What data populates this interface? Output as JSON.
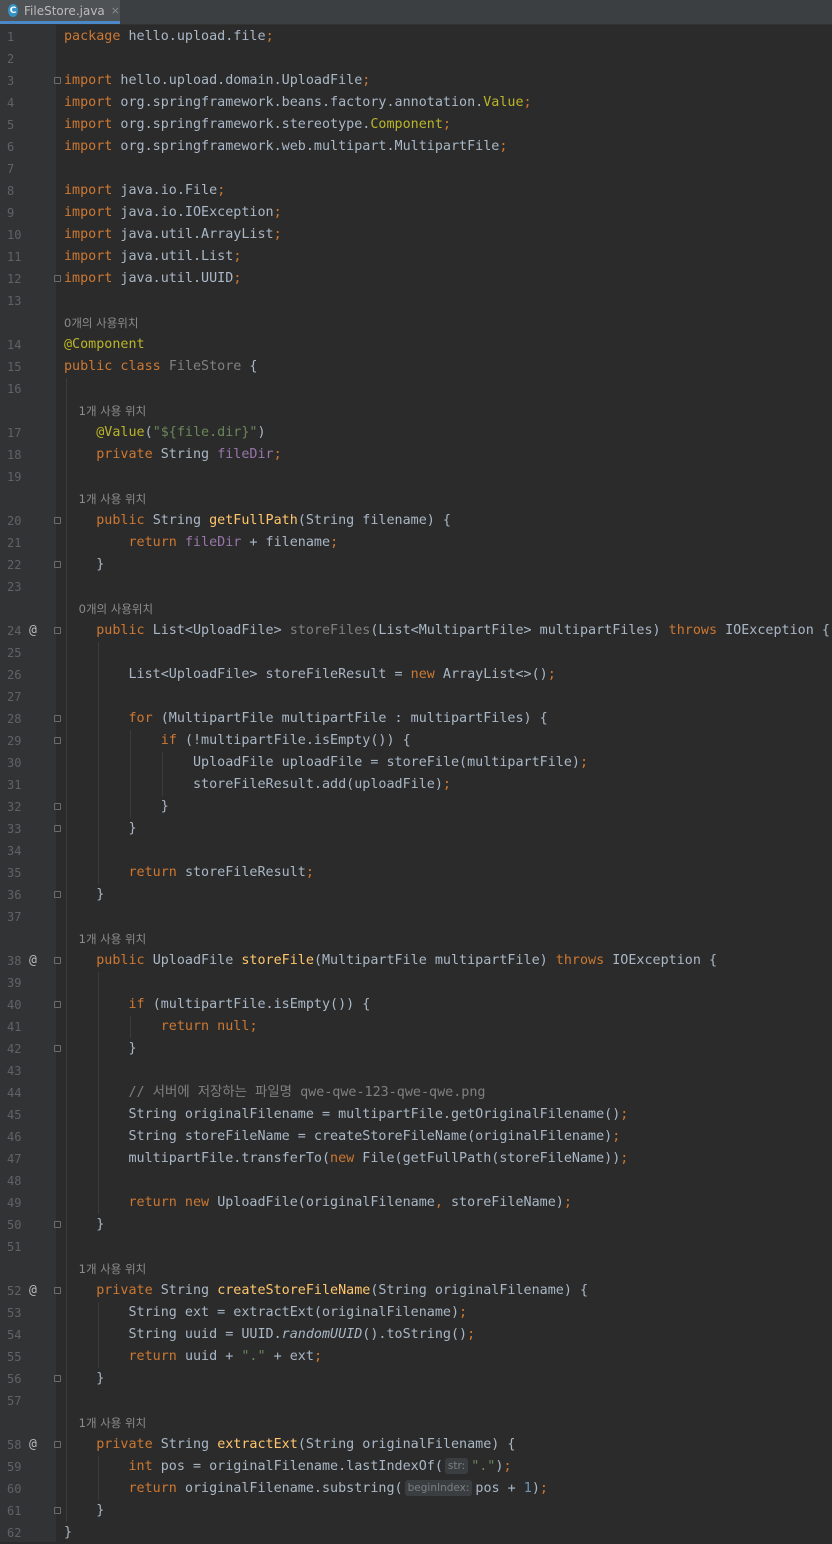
{
  "tab": {
    "filename": "FileStore.java",
    "icon": "class-icon",
    "icon_letter": "C",
    "close": "×"
  },
  "rows": [
    {
      "t": "line",
      "n": "1",
      "c": [
        [
          "package",
          "kw"
        ],
        [
          " hello.upload.file",
          ""
        ],
        [
          ";",
          "kw"
        ]
      ]
    },
    {
      "t": "line",
      "n": "2",
      "c": []
    },
    {
      "t": "line",
      "n": "3",
      "f": 1,
      "c": [
        [
          "import",
          "kw"
        ],
        [
          " hello.upload.domain.UploadFile",
          ""
        ],
        [
          ";",
          "kw"
        ]
      ]
    },
    {
      "t": "line",
      "n": "4",
      "c": [
        [
          "import",
          "kw"
        ],
        [
          " org.springframework.beans.factory.annotation.",
          ""
        ],
        [
          "Value",
          "ann"
        ],
        [
          ";",
          "kw"
        ]
      ]
    },
    {
      "t": "line",
      "n": "5",
      "c": [
        [
          "import",
          "kw"
        ],
        [
          " org.springframework.stereotype.",
          ""
        ],
        [
          "Component",
          "ann"
        ],
        [
          ";",
          "kw"
        ]
      ]
    },
    {
      "t": "line",
      "n": "6",
      "c": [
        [
          "import",
          "kw"
        ],
        [
          " org.springframework.web.multipart.MultipartFile",
          ""
        ],
        [
          ";",
          "kw"
        ]
      ]
    },
    {
      "t": "line",
      "n": "7",
      "c": []
    },
    {
      "t": "line",
      "n": "8",
      "c": [
        [
          "import",
          "kw"
        ],
        [
          " java.io.File",
          ""
        ],
        [
          ";",
          "kw"
        ]
      ]
    },
    {
      "t": "line",
      "n": "9",
      "c": [
        [
          "import",
          "kw"
        ],
        [
          " java.io.IOException",
          ""
        ],
        [
          ";",
          "kw"
        ]
      ]
    },
    {
      "t": "line",
      "n": "10",
      "c": [
        [
          "import",
          "kw"
        ],
        [
          " java.util.ArrayList",
          ""
        ],
        [
          ";",
          "kw"
        ]
      ]
    },
    {
      "t": "line",
      "n": "11",
      "c": [
        [
          "import",
          "kw"
        ],
        [
          " java.util.List",
          ""
        ],
        [
          ";",
          "kw"
        ]
      ]
    },
    {
      "t": "line",
      "n": "12",
      "f": 1,
      "c": [
        [
          "import",
          "kw"
        ],
        [
          " java.util.UUID",
          ""
        ],
        [
          ";",
          "kw"
        ]
      ]
    },
    {
      "t": "line",
      "n": "13",
      "c": []
    },
    {
      "t": "hint",
      "c": [
        [
          "0개의 사용위치",
          ""
        ]
      ]
    },
    {
      "t": "line",
      "n": "14",
      "c": [
        [
          "@Component",
          "ann"
        ]
      ]
    },
    {
      "t": "line",
      "n": "15",
      "c": [
        [
          "public class ",
          "kw"
        ],
        [
          "FileStore",
          "gr"
        ],
        [
          " {",
          ""
        ]
      ]
    },
    {
      "t": "line",
      "n": "16",
      "c": []
    },
    {
      "t": "hint",
      "c": [
        [
          "    1개 사용 위치",
          ""
        ]
      ]
    },
    {
      "t": "line",
      "n": "17",
      "c": [
        [
          "    ",
          ""
        ],
        [
          "@Value",
          "ann"
        ],
        [
          "(",
          ""
        ],
        [
          "\"${file.dir}\"",
          "str"
        ],
        [
          ")",
          ""
        ]
      ]
    },
    {
      "t": "line",
      "n": "18",
      "c": [
        [
          "    ",
          ""
        ],
        [
          "private ",
          "kw"
        ],
        [
          "String ",
          ""
        ],
        [
          "fileDir",
          "fld"
        ],
        [
          ";",
          "kw"
        ]
      ]
    },
    {
      "t": "line",
      "n": "19",
      "c": []
    },
    {
      "t": "hint",
      "c": [
        [
          "    1개 사용 위치",
          ""
        ]
      ]
    },
    {
      "t": "line",
      "n": "20",
      "f": 1,
      "c": [
        [
          "    ",
          ""
        ],
        [
          "public ",
          "kw"
        ],
        [
          "String ",
          ""
        ],
        [
          "getFullPath",
          "fn"
        ],
        [
          "(String filename) {",
          ""
        ]
      ]
    },
    {
      "t": "line",
      "n": "21",
      "c": [
        [
          "        ",
          ""
        ],
        [
          "return ",
          "kw"
        ],
        [
          "fileDir",
          "fld"
        ],
        [
          " + filename",
          ""
        ],
        [
          ";",
          "kw"
        ]
      ]
    },
    {
      "t": "line",
      "n": "22",
      "f": 1,
      "c": [
        [
          "    }",
          ""
        ]
      ]
    },
    {
      "t": "line",
      "n": "23",
      "c": []
    },
    {
      "t": "hint",
      "c": [
        [
          "    0개의 사용위치",
          ""
        ]
      ]
    },
    {
      "t": "line",
      "n": "24",
      "m": "@",
      "f": 1,
      "c": [
        [
          "    ",
          ""
        ],
        [
          "public ",
          "kw"
        ],
        [
          "List<UploadFile> ",
          ""
        ],
        [
          "storeFiles",
          "gr"
        ],
        [
          "(List<MultipartFile> multipartFiles) ",
          ""
        ],
        [
          "throws ",
          "kw"
        ],
        [
          "IOException {",
          ""
        ]
      ]
    },
    {
      "t": "line",
      "n": "25",
      "c": []
    },
    {
      "t": "line",
      "n": "26",
      "c": [
        [
          "        List<UploadFile> storeFileResult = ",
          ""
        ],
        [
          "new ",
          "kw"
        ],
        [
          "ArrayList<>()",
          ""
        ],
        [
          ";",
          "kw"
        ]
      ]
    },
    {
      "t": "line",
      "n": "27",
      "c": []
    },
    {
      "t": "line",
      "n": "28",
      "f": 1,
      "c": [
        [
          "        ",
          ""
        ],
        [
          "for ",
          "kw"
        ],
        [
          "(MultipartFile multipartFile : multipartFiles) {",
          ""
        ]
      ]
    },
    {
      "t": "line",
      "n": "29",
      "f": 1,
      "c": [
        [
          "            ",
          ""
        ],
        [
          "if ",
          "kw"
        ],
        [
          "(!multipartFile.isEmpty()) {",
          ""
        ]
      ]
    },
    {
      "t": "line",
      "n": "30",
      "c": [
        [
          "                UploadFile uploadFile = storeFile(multipartFile)",
          ""
        ],
        [
          ";",
          "kw"
        ]
      ]
    },
    {
      "t": "line",
      "n": "31",
      "c": [
        [
          "                storeFileResult.add(uploadFile)",
          ""
        ],
        [
          ";",
          "kw"
        ]
      ]
    },
    {
      "t": "line",
      "n": "32",
      "f": 1,
      "c": [
        [
          "            }",
          ""
        ]
      ]
    },
    {
      "t": "line",
      "n": "33",
      "f": 1,
      "c": [
        [
          "        }",
          ""
        ]
      ]
    },
    {
      "t": "line",
      "n": "34",
      "c": []
    },
    {
      "t": "line",
      "n": "35",
      "c": [
        [
          "        ",
          ""
        ],
        [
          "return ",
          "kw"
        ],
        [
          "storeFileResult",
          ""
        ],
        [
          ";",
          "kw"
        ]
      ]
    },
    {
      "t": "line",
      "n": "36",
      "f": 1,
      "c": [
        [
          "    }",
          ""
        ]
      ]
    },
    {
      "t": "line",
      "n": "37",
      "c": []
    },
    {
      "t": "hint",
      "c": [
        [
          "    1개 사용 위치",
          ""
        ]
      ]
    },
    {
      "t": "line",
      "n": "38",
      "m": "@",
      "f": 1,
      "c": [
        [
          "    ",
          ""
        ],
        [
          "public ",
          "kw"
        ],
        [
          "UploadFile ",
          ""
        ],
        [
          "storeFile",
          "fn"
        ],
        [
          "(MultipartFile multipartFile) ",
          ""
        ],
        [
          "throws ",
          "kw"
        ],
        [
          "IOException {",
          ""
        ]
      ]
    },
    {
      "t": "line",
      "n": "39",
      "c": []
    },
    {
      "t": "line",
      "n": "40",
      "f": 1,
      "c": [
        [
          "        ",
          ""
        ],
        [
          "if ",
          "kw"
        ],
        [
          "(multipartFile.isEmpty()) {",
          ""
        ]
      ]
    },
    {
      "t": "line",
      "n": "41",
      "c": [
        [
          "            ",
          ""
        ],
        [
          "return null",
          "kw"
        ],
        [
          ";",
          "kw"
        ]
      ]
    },
    {
      "t": "line",
      "n": "42",
      "f": 1,
      "c": [
        [
          "        }",
          ""
        ]
      ]
    },
    {
      "t": "line",
      "n": "43",
      "c": []
    },
    {
      "t": "line",
      "n": "44",
      "c": [
        [
          "        ",
          ""
        ],
        [
          "// 서버에 저장하는 파일명 qwe-qwe-123-qwe-qwe.png",
          "cmt"
        ]
      ]
    },
    {
      "t": "line",
      "n": "45",
      "c": [
        [
          "        String originalFilename = multipartFile.getOriginalFilename()",
          ""
        ],
        [
          ";",
          "kw"
        ]
      ]
    },
    {
      "t": "line",
      "n": "46",
      "c": [
        [
          "        String storeFileName = createStoreFileName(originalFilename)",
          ""
        ],
        [
          ";",
          "kw"
        ]
      ]
    },
    {
      "t": "line",
      "n": "47",
      "c": [
        [
          "        multipartFile.transferTo(",
          ""
        ],
        [
          "new ",
          "kw"
        ],
        [
          "File(getFullPath(storeFileName))",
          ""
        ],
        [
          ";",
          "kw"
        ]
      ]
    },
    {
      "t": "line",
      "n": "48",
      "c": []
    },
    {
      "t": "line",
      "n": "49",
      "c": [
        [
          "        ",
          ""
        ],
        [
          "return new ",
          "kw"
        ],
        [
          "UploadFile(originalFilename",
          ""
        ],
        [
          ", ",
          "kw"
        ],
        [
          "storeFileName)",
          ""
        ],
        [
          ";",
          "kw"
        ]
      ]
    },
    {
      "t": "line",
      "n": "50",
      "f": 1,
      "c": [
        [
          "    }",
          ""
        ]
      ]
    },
    {
      "t": "line",
      "n": "51",
      "c": []
    },
    {
      "t": "hint",
      "c": [
        [
          "    1개 사용 위치",
          ""
        ]
      ]
    },
    {
      "t": "line",
      "n": "52",
      "m": "@",
      "f": 1,
      "c": [
        [
          "    ",
          ""
        ],
        [
          "private ",
          "kw"
        ],
        [
          "String ",
          ""
        ],
        [
          "createStoreFileName",
          "fn"
        ],
        [
          "(String originalFilename) {",
          ""
        ]
      ]
    },
    {
      "t": "line",
      "n": "53",
      "c": [
        [
          "        String ext = extractExt(originalFilename)",
          ""
        ],
        [
          ";",
          "kw"
        ]
      ]
    },
    {
      "t": "line",
      "n": "54",
      "c": [
        [
          "        String uuid = UUID.",
          ""
        ],
        [
          "randomUUID",
          "it"
        ],
        [
          "().toString()",
          ""
        ],
        [
          ";",
          "kw"
        ]
      ]
    },
    {
      "t": "line",
      "n": "55",
      "c": [
        [
          "        ",
          ""
        ],
        [
          "return ",
          "kw"
        ],
        [
          "uuid + ",
          ""
        ],
        [
          "\".\"",
          "str"
        ],
        [
          " + ext",
          ""
        ],
        [
          ";",
          "kw"
        ]
      ]
    },
    {
      "t": "line",
      "n": "56",
      "f": 1,
      "c": [
        [
          "    }",
          ""
        ]
      ]
    },
    {
      "t": "line",
      "n": "57",
      "c": []
    },
    {
      "t": "hint",
      "c": [
        [
          "    1개 사용 위치",
          ""
        ]
      ]
    },
    {
      "t": "line",
      "n": "58",
      "m": "@",
      "f": 1,
      "c": [
        [
          "    ",
          ""
        ],
        [
          "private ",
          "kw"
        ],
        [
          "String ",
          ""
        ],
        [
          "extractExt",
          "fn"
        ],
        [
          "(String originalFilename) {",
          ""
        ]
      ]
    },
    {
      "t": "line",
      "n": "59",
      "c": [
        [
          "        ",
          ""
        ],
        [
          "int ",
          "kw"
        ],
        [
          "pos = originalFilename.lastIndexOf(",
          ""
        ],
        [
          "str:",
          "ph"
        ],
        [
          "\".\"",
          "str"
        ],
        [
          ")",
          ""
        ],
        [
          ";",
          "kw"
        ]
      ]
    },
    {
      "t": "line",
      "n": "60",
      "c": [
        [
          "        ",
          ""
        ],
        [
          "return ",
          "kw"
        ],
        [
          "originalFilename.substring(",
          ""
        ],
        [
          "beginIndex:",
          "ph"
        ],
        [
          "pos + ",
          ""
        ],
        [
          "1",
          "num"
        ],
        [
          ")",
          ""
        ],
        [
          ";",
          "kw"
        ]
      ]
    },
    {
      "t": "line",
      "n": "61",
      "f": 1,
      "c": [
        [
          "    }",
          ""
        ]
      ]
    },
    {
      "t": "line",
      "n": "62",
      "c": [
        [
          "}",
          ""
        ]
      ]
    }
  ]
}
